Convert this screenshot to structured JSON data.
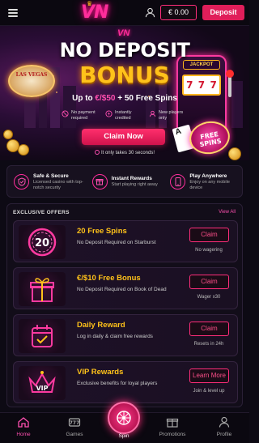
{
  "header": {
    "logo": "VN",
    "balance": "€ 0.00",
    "deposit_label": "Deposit"
  },
  "hero": {
    "logo_small": "VN",
    "title_line1": "NO DEPOSIT",
    "title_line2": "BONUS",
    "offer_prefix": "Up to ",
    "offer_amount": "€/$50",
    "offer_suffix": " + 50 Free Spins",
    "badges": [
      {
        "icon": "no-payment-icon",
        "text": "No payment required"
      },
      {
        "icon": "instant-credit-icon",
        "text": "Instantly credited"
      },
      {
        "icon": "new-player-icon",
        "text": "New players only"
      }
    ],
    "claim_label": "Claim Now",
    "note": "It only takes 30 seconds!",
    "vegas_sign": "LAS VEGAS",
    "jackpot": "JACKPOT",
    "reels": [
      "7",
      "7",
      "7"
    ],
    "chip_text": "FREE SPINS",
    "card": "A"
  },
  "features": [
    {
      "icon": "shield-icon",
      "title": "Safe & Secure",
      "text": "Licensed casino with top-notch security"
    },
    {
      "icon": "gift-icon",
      "title": "Instant Rewards",
      "text": "Start playing right away"
    },
    {
      "icon": "phone-icon",
      "title": "Play Anywhere",
      "text": "Enjoy on any mobile device"
    }
  ],
  "offers": {
    "heading": "EXCLUSIVE OFFERS",
    "view_all": "View All",
    "items": [
      {
        "icon": "spins-20-icon",
        "icon_text": "20",
        "title": "20 Free Spins",
        "desc": "No Deposit Required on Starburst",
        "button": "Claim",
        "sub": "No wagering"
      },
      {
        "icon": "gift-box-icon",
        "title": "€/$10 Free Bonus",
        "desc": "No Deposit Required on Book of Dead",
        "button": "Claim",
        "sub": "Wager x30"
      },
      {
        "icon": "calendar-icon",
        "title": "Daily Reward",
        "desc": "Log in daily & claim free rewards",
        "button": "Claim",
        "sub": "Resets in 24h"
      },
      {
        "icon": "crown-vip-icon",
        "icon_text": "VIP",
        "title": "VIP Rewards",
        "desc": "Exclusive benefits for loyal players",
        "button": "Learn More",
        "sub": "Join & level up"
      }
    ]
  },
  "nav": {
    "home": "Home",
    "games": "Games",
    "spin": "Spin",
    "promotions": "Promotions",
    "profile": "Profile"
  },
  "colors": {
    "accent_pink": "#ff2d9b",
    "gold": "#ffc21a",
    "deposit_red": "#e01e5a",
    "background": "#0d0a14"
  }
}
